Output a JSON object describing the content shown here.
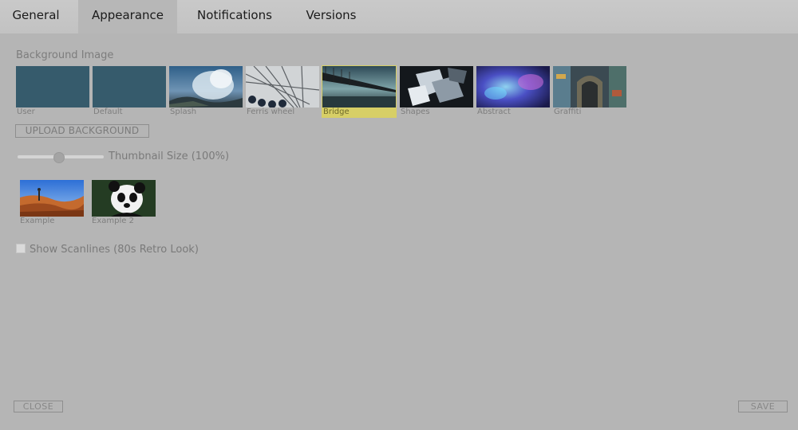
{
  "tabs": [
    {
      "label": "General"
    },
    {
      "label": "Appearance",
      "active": true
    },
    {
      "label": "Notifications"
    },
    {
      "label": "Versions"
    }
  ],
  "background": {
    "section_label": "Background Image",
    "thumbnails": [
      {
        "label": "User",
        "color": "#365b6c"
      },
      {
        "label": "Default",
        "color": "#365b6c"
      },
      {
        "label": "Splash"
      },
      {
        "label": "Ferris wheel"
      },
      {
        "label": "Bridge",
        "selected": true
      },
      {
        "label": "Shapes"
      },
      {
        "label": "Abstract"
      },
      {
        "label": "Graffiti"
      }
    ],
    "upload_label": "UPLOAD BACKGROUND"
  },
  "thumbnail_size": {
    "label": "Thumbnail Size (100%)",
    "slider_fraction": 0.48
  },
  "examples": [
    {
      "label": "Example"
    },
    {
      "label": "Example 2"
    }
  ],
  "scanlines": {
    "label": "Show Scanlines (80s Retro Look)",
    "checked": false
  },
  "footer": {
    "close_label": "CLOSE",
    "save_label": "SAVE"
  },
  "colors": {
    "selected_highlight": "#d7cf66",
    "panel_background": "#b5b5b5"
  }
}
